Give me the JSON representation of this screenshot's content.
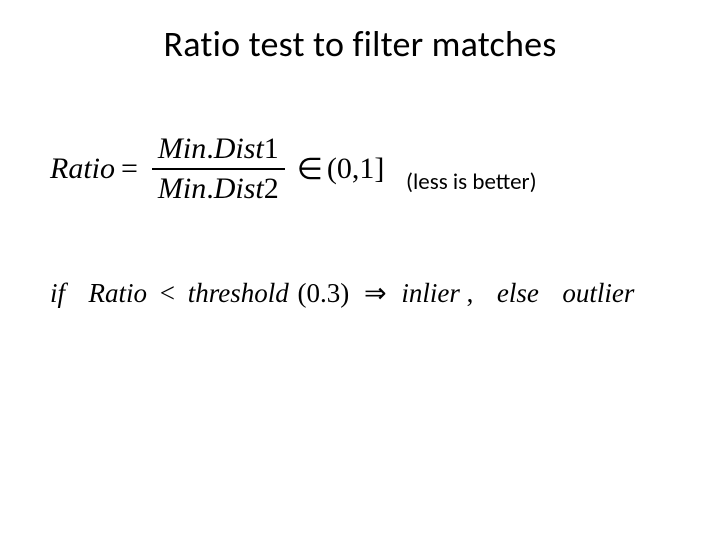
{
  "title": "Ratio test to filter matches",
  "formula1": {
    "lhs": "Ratio",
    "eq": "=",
    "numerator_label": "Min",
    "numerator_dot": ".",
    "numerator_word": "Dist",
    "numerator_num": "1",
    "denominator_label": "Min",
    "denominator_dot": ".",
    "denominator_word": "Dist",
    "denominator_num": "2",
    "in": "∈",
    "interval": "(0,1]"
  },
  "note": "(less is better)",
  "formula2": {
    "if": "if",
    "ratio": "Ratio",
    "lt": "<",
    "threshold": "threshold",
    "thval": "(0.3)",
    "implies": "⇒",
    "inlier": "inlier",
    "comma": ",",
    "else": "else",
    "outlier": "outlier"
  }
}
